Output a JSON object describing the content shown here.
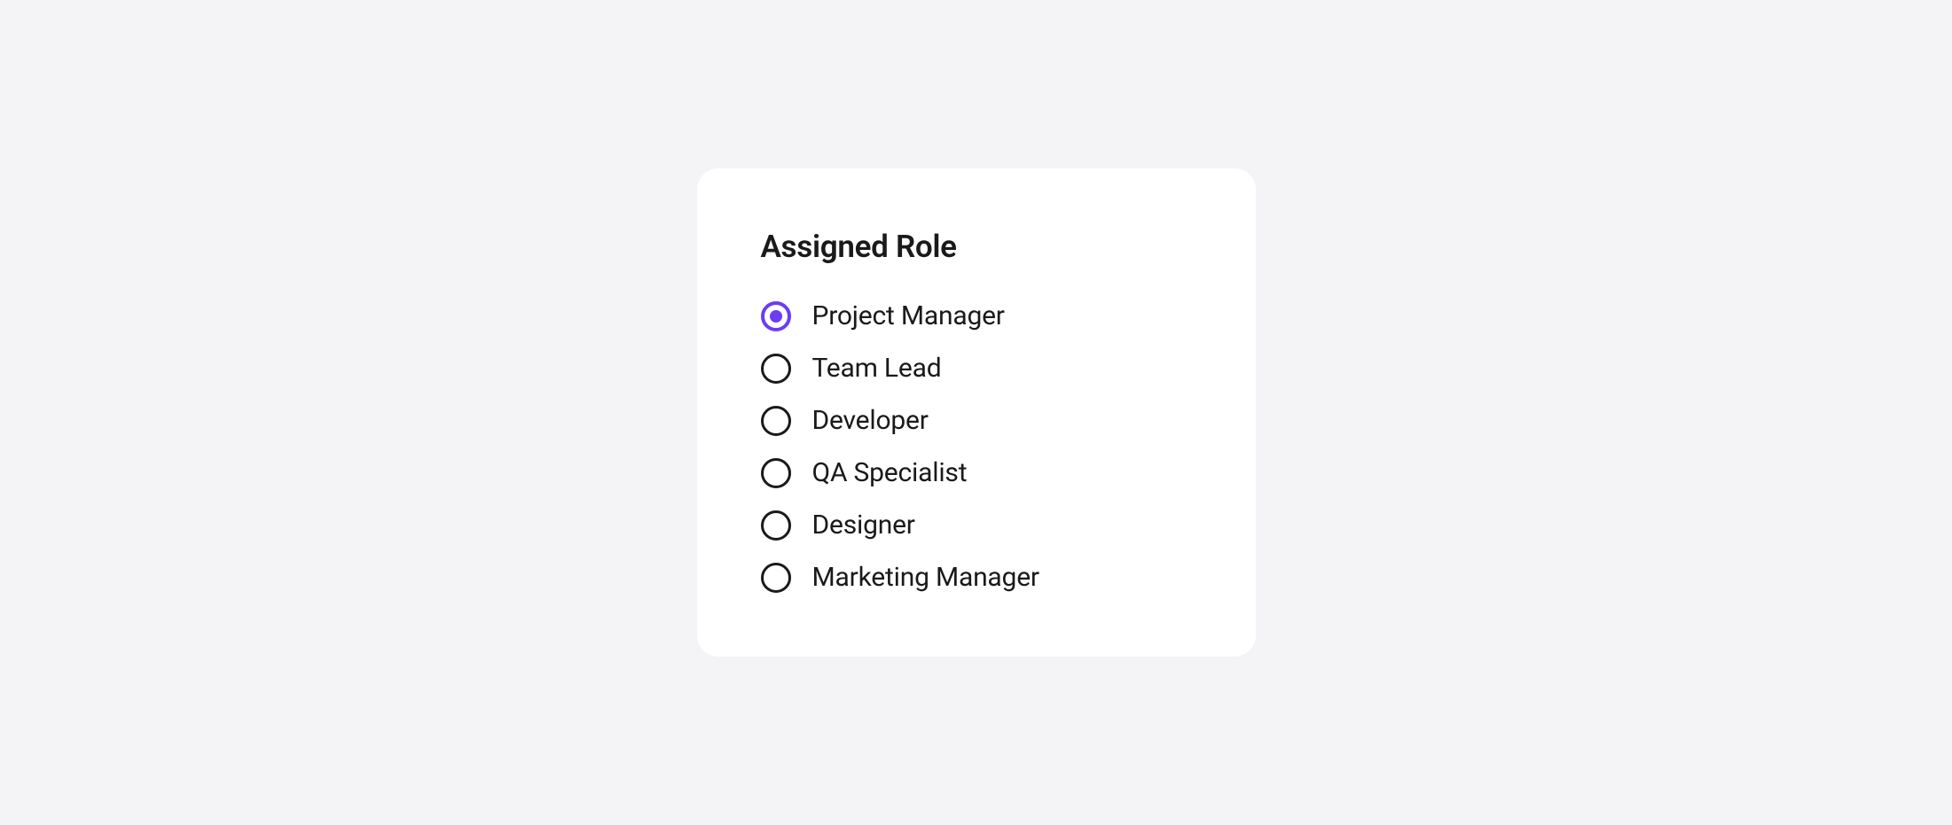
{
  "card": {
    "title": "Assigned Role",
    "options": [
      {
        "label": "Project Manager",
        "selected": true
      },
      {
        "label": "Team Lead",
        "selected": false
      },
      {
        "label": "Developer",
        "selected": false
      },
      {
        "label": "QA Specialist",
        "selected": false
      },
      {
        "label": "Designer",
        "selected": false
      },
      {
        "label": "Marketing Manager",
        "selected": false
      }
    ]
  },
  "colors": {
    "accent": "#6b3df5",
    "background": "#f4f4f6",
    "card": "#ffffff",
    "text": "#1a1a1a"
  }
}
